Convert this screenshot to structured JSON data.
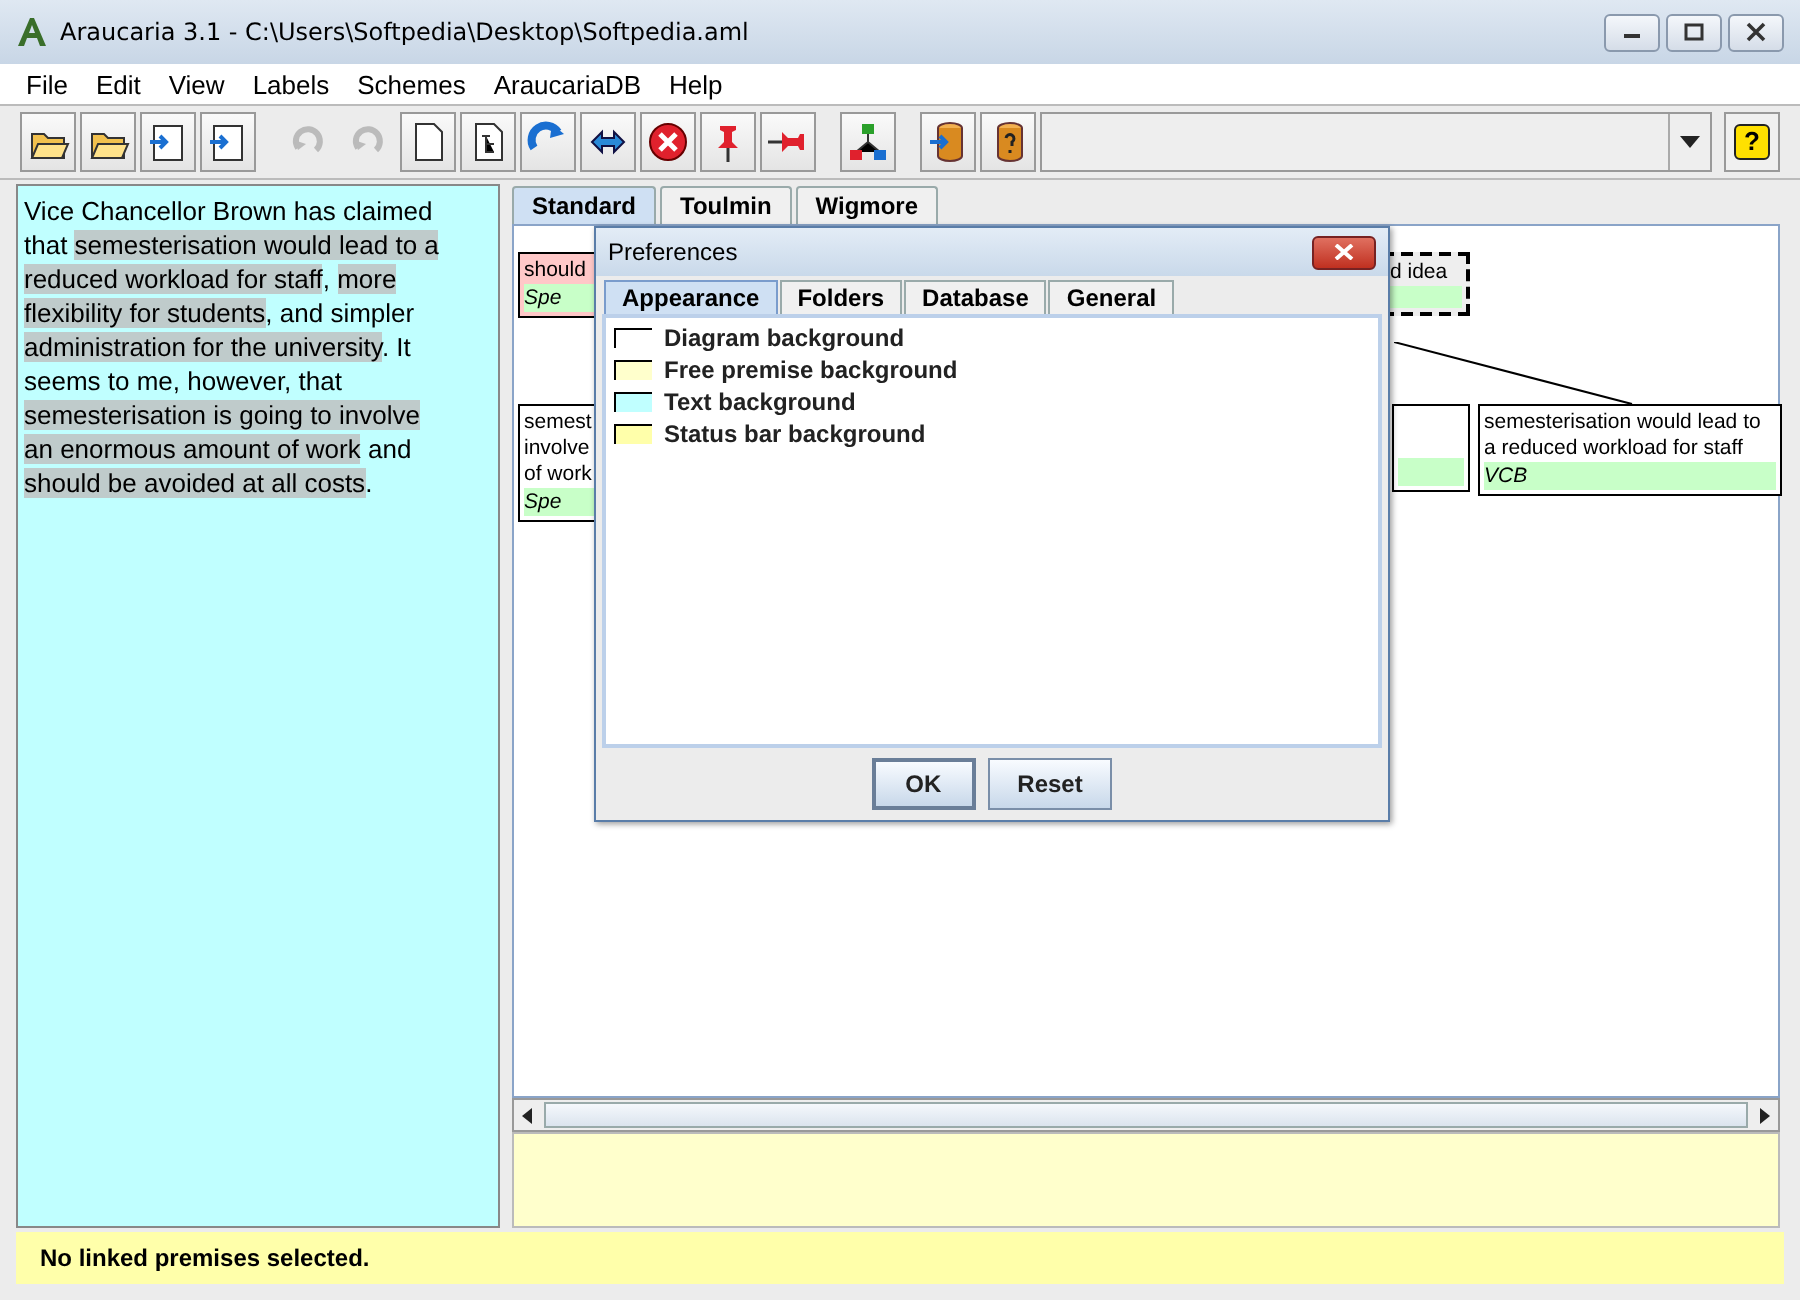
{
  "window": {
    "title": "Araucaria 3.1  - C:\\Users\\Softpedia\\Desktop\\Softpedia.aml"
  },
  "menu": [
    "File",
    "Edit",
    "View",
    "Labels",
    "Schemes",
    "AraucariaDB",
    "Help"
  ],
  "toolbar": {
    "groups": [
      [
        {
          "disabled": false
        },
        {
          "disabled": false
        },
        {
          "disabled": false
        },
        {
          "disabled": false
        }
      ],
      [
        {
          "disabled": true
        },
        {
          "disabled": true
        },
        {
          "disabled": false
        },
        {
          "disabled": false
        },
        {
          "disabled": false
        },
        {
          "disabled": false
        },
        {
          "disabled": false
        },
        {
          "disabled": false
        },
        {
          "disabled": false
        }
      ],
      [
        {
          "disabled": false
        }
      ],
      [
        {
          "disabled": false
        },
        {
          "disabled": false
        }
      ]
    ],
    "help_button": "?"
  },
  "text_panel": {
    "segments": [
      {
        "text": "Vice Chancellor Brown has claimed that ",
        "highlighted": false
      },
      {
        "text": "semesterisation would lead to a reduced workload for staff",
        "highlighted": true
      },
      {
        "text": ", ",
        "highlighted": false
      },
      {
        "text": "more flexibility for students",
        "highlighted": true
      },
      {
        "text": ", and simpler ",
        "highlighted": false
      },
      {
        "text": "administration for the university",
        "highlighted": true
      },
      {
        "text": ". It seems to me, however, that ",
        "highlighted": false
      },
      {
        "text": "semesterisation is going to involve an enormous amount of work",
        "highlighted": true
      },
      {
        "text": " and ",
        "highlighted": false
      },
      {
        "text": "should be avoided at all costs",
        "highlighted": true
      },
      {
        "text": ".",
        "highlighted": false
      }
    ]
  },
  "tabs": [
    {
      "label": "Standard",
      "selected": true
    },
    {
      "label": "Toulmin",
      "selected": false
    },
    {
      "label": "Wigmore",
      "selected": false
    }
  ],
  "diagram": {
    "nodes": [
      {
        "kind": "claim",
        "text": "should",
        "owner": "Spe"
      },
      {
        "kind": "dashed",
        "text": "d idea"
      },
      {
        "kind": "premise",
        "text": "semest\ninvolve\nof work",
        "owner": "Spe"
      },
      {
        "kind": "premise_hidden"
      },
      {
        "kind": "premise",
        "text": "semesterisation would lead to a reduced workload for staff",
        "owner": "VCB"
      }
    ]
  },
  "preferences": {
    "title": "Preferences",
    "tabs": [
      {
        "label": "Appearance",
        "selected": true
      },
      {
        "label": "Folders",
        "selected": false
      },
      {
        "label": "Database",
        "selected": false
      },
      {
        "label": "General",
        "selected": false
      }
    ],
    "colors": [
      {
        "label": "Diagram background",
        "color": "#ffffff"
      },
      {
        "label": "Free premise background",
        "color": "#ffffcc"
      },
      {
        "label": "Text background",
        "color": "#c0ffff"
      },
      {
        "label": "Status bar background",
        "color": "#ffffaa"
      }
    ],
    "buttons": [
      "OK",
      "Reset"
    ]
  },
  "status_bar": "No linked premises selected."
}
